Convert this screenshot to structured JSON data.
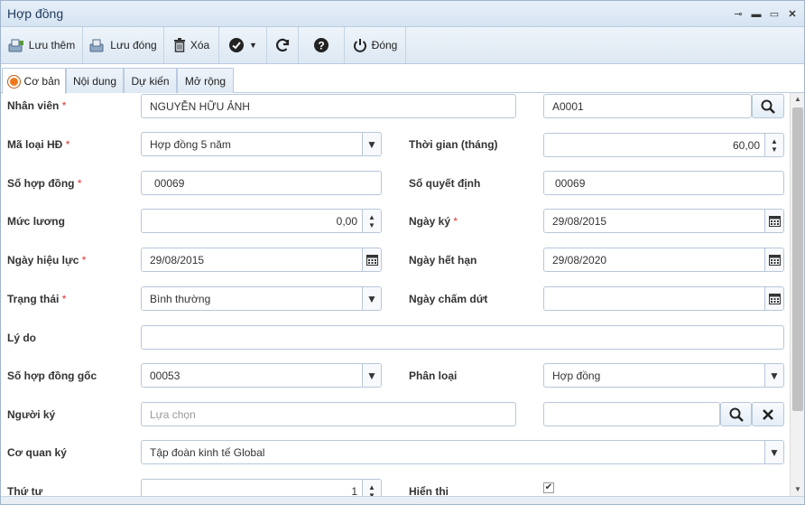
{
  "window": {
    "title": "Hợp đồng"
  },
  "toolbar": {
    "save_add": "Lưu thêm",
    "save_close": "Lưu đóng",
    "delete": "Xóa",
    "close": "Đóng"
  },
  "tabs": [
    "Cơ bản",
    "Nội dung",
    "Dự kiến",
    "Mở rộng"
  ],
  "form": {
    "employee": {
      "label": "Nhân viên",
      "required": "*",
      "value": "NGUYỄN HỮU ẢNH",
      "code": "A0001"
    },
    "contract_type": {
      "label": "Mã loại HĐ",
      "required": "*",
      "value": "Hợp đồng 5 năm"
    },
    "duration": {
      "label": "Thời gian (tháng)",
      "value": "60,00"
    },
    "contract_no": {
      "label": "Số hợp đồng",
      "required": "*",
      "value": "00069"
    },
    "decision_no": {
      "label": "Số quyết định",
      "value": "00069"
    },
    "salary": {
      "label": "Mức lương",
      "value": "0,00"
    },
    "sign_date": {
      "label": "Ngày ký",
      "required": "*",
      "value": "29/08/2015"
    },
    "effective_date": {
      "label": "Ngày hiệu lực",
      "required": "*",
      "value": "29/08/2015"
    },
    "expiry_date": {
      "label": "Ngày hết hạn",
      "value": "29/08/2020"
    },
    "status": {
      "label": "Trạng thái",
      "required": "*",
      "value": "Bình thường"
    },
    "end_date": {
      "label": "Ngày chấm dứt",
      "value": ""
    },
    "reason": {
      "label": "Lý do",
      "value": ""
    },
    "original_no": {
      "label": "Số hợp đồng gốc",
      "value": "00053"
    },
    "category": {
      "label": "Phân loại",
      "value": "Hợp đồng"
    },
    "signer": {
      "label": "Người ký",
      "placeholder": "Lựa chọn",
      "value": ""
    },
    "agency": {
      "label": "Cơ quan ký",
      "value": "Tập đoàn kinh tế Global"
    },
    "order": {
      "label": "Thứ tự",
      "value": "1"
    },
    "visible": {
      "label": "Hiển thị",
      "checked": true
    }
  }
}
